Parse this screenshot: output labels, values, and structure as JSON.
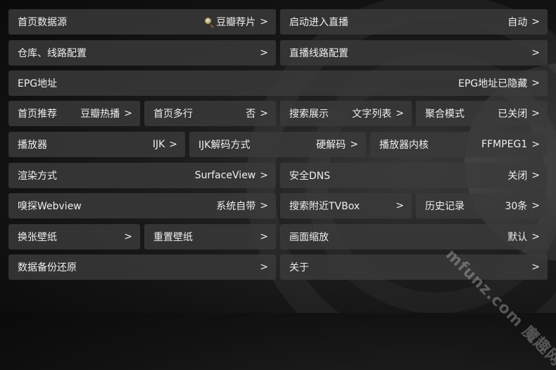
{
  "rows": [
    [
      {
        "label": "首页数据源",
        "value": "豆瓣荐片",
        "icon": "magnifier-icon"
      },
      {
        "label": "启动进入直播",
        "value": "自动"
      }
    ],
    [
      {
        "label": "仓库、线路配置",
        "value": ""
      },
      {
        "label": "直播线路配置",
        "value": ""
      }
    ],
    [
      {
        "label": "EPG地址",
        "value": "EPG地址已隐藏"
      }
    ],
    [
      {
        "label": "首页推荐",
        "value": "豆瓣热播"
      },
      {
        "label": "首页多行",
        "value": "否"
      },
      {
        "label": "搜索展示",
        "value": "文字列表"
      },
      {
        "label": "聚合模式",
        "value": "已关闭"
      }
    ],
    [
      {
        "label": "播放器",
        "value": "IJK"
      },
      {
        "label": "IJK解码方式",
        "value": "硬解码"
      },
      {
        "label": "播放器内核",
        "value": "FFMPEG1"
      }
    ],
    [
      {
        "label": "渲染方式",
        "value": "SurfaceView"
      },
      {
        "label": "安全DNS",
        "value": "关闭"
      }
    ],
    [
      {
        "label": "嗅探Webview",
        "value": "系统自带"
      },
      {
        "label": "搜索附近TVBox",
        "value": ""
      },
      {
        "label": "历史记录",
        "value": "30条"
      }
    ],
    [
      {
        "label": "换张壁纸",
        "value": ""
      },
      {
        "label": "重置壁纸",
        "value": ""
      },
      {
        "label": "画面缩放",
        "value": "默认"
      }
    ],
    [
      {
        "label": "数据备份还原",
        "value": ""
      },
      {
        "label": "关于",
        "value": ""
      }
    ]
  ],
  "arrow_glyph": ">",
  "watermark": "mfunz.com 魔趣网"
}
